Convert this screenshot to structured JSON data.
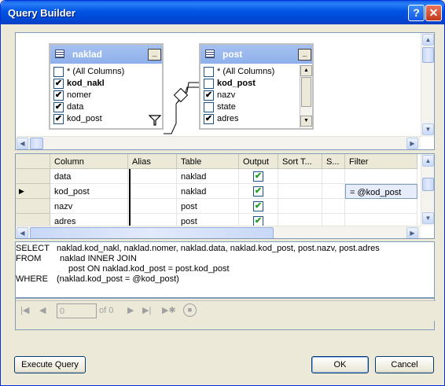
{
  "window": {
    "title": "Query Builder",
    "help_label": "?",
    "close_label": "✕"
  },
  "tables": [
    {
      "name": "naklad",
      "min_label": "_",
      "columns": [
        {
          "label": "* (All Columns)",
          "checked": false,
          "bold": false
        },
        {
          "label": "kod_nakl",
          "checked": true,
          "bold": true
        },
        {
          "label": "nomer",
          "checked": true,
          "bold": false
        },
        {
          "label": "data",
          "checked": true,
          "bold": false
        },
        {
          "label": "kod_post",
          "checked": true,
          "bold": false
        }
      ]
    },
    {
      "name": "post",
      "min_label": "_",
      "columns": [
        {
          "label": "* (All Columns)",
          "checked": false,
          "bold": false
        },
        {
          "label": "kod_post",
          "checked": false,
          "bold": true
        },
        {
          "label": "nazv",
          "checked": true,
          "bold": false
        },
        {
          "label": "state",
          "checked": false,
          "bold": false
        },
        {
          "label": "adres",
          "checked": true,
          "bold": false
        }
      ]
    }
  ],
  "grid": {
    "headers": [
      "Column",
      "Alias",
      "Table",
      "Output",
      "Sort T...",
      "S...",
      "Filter"
    ],
    "rows": [
      {
        "column": "data",
        "alias": "",
        "table": "naklad",
        "output": true,
        "filter": ""
      },
      {
        "column": "kod_post",
        "alias": "",
        "table": "naklad",
        "output": true,
        "filter": "= @kod_post"
      },
      {
        "column": "nazv",
        "alias": "",
        "table": "post",
        "output": true,
        "filter": ""
      },
      {
        "column": "adres",
        "alias": "",
        "table": "post",
        "output": true,
        "filter": ""
      }
    ]
  },
  "sql": {
    "lines": [
      {
        "kw": "SELECT",
        "text": "naklad.kod_nakl, naklad.nomer, naklad.data, naklad.kod_post, post.nazv, post.adres"
      },
      {
        "kw": "FROM",
        "text": "naklad INNER JOIN"
      },
      {
        "kw": "",
        "text": "post ON naklad.kod_post = post.kod_post"
      },
      {
        "kw": "WHERE",
        "text": "(naklad.kod_post = @kod_post)"
      }
    ]
  },
  "navigator": {
    "position": "0",
    "of_label": "of 0"
  },
  "buttons": {
    "execute": "Execute Query",
    "ok": "OK",
    "cancel": "Cancel"
  }
}
